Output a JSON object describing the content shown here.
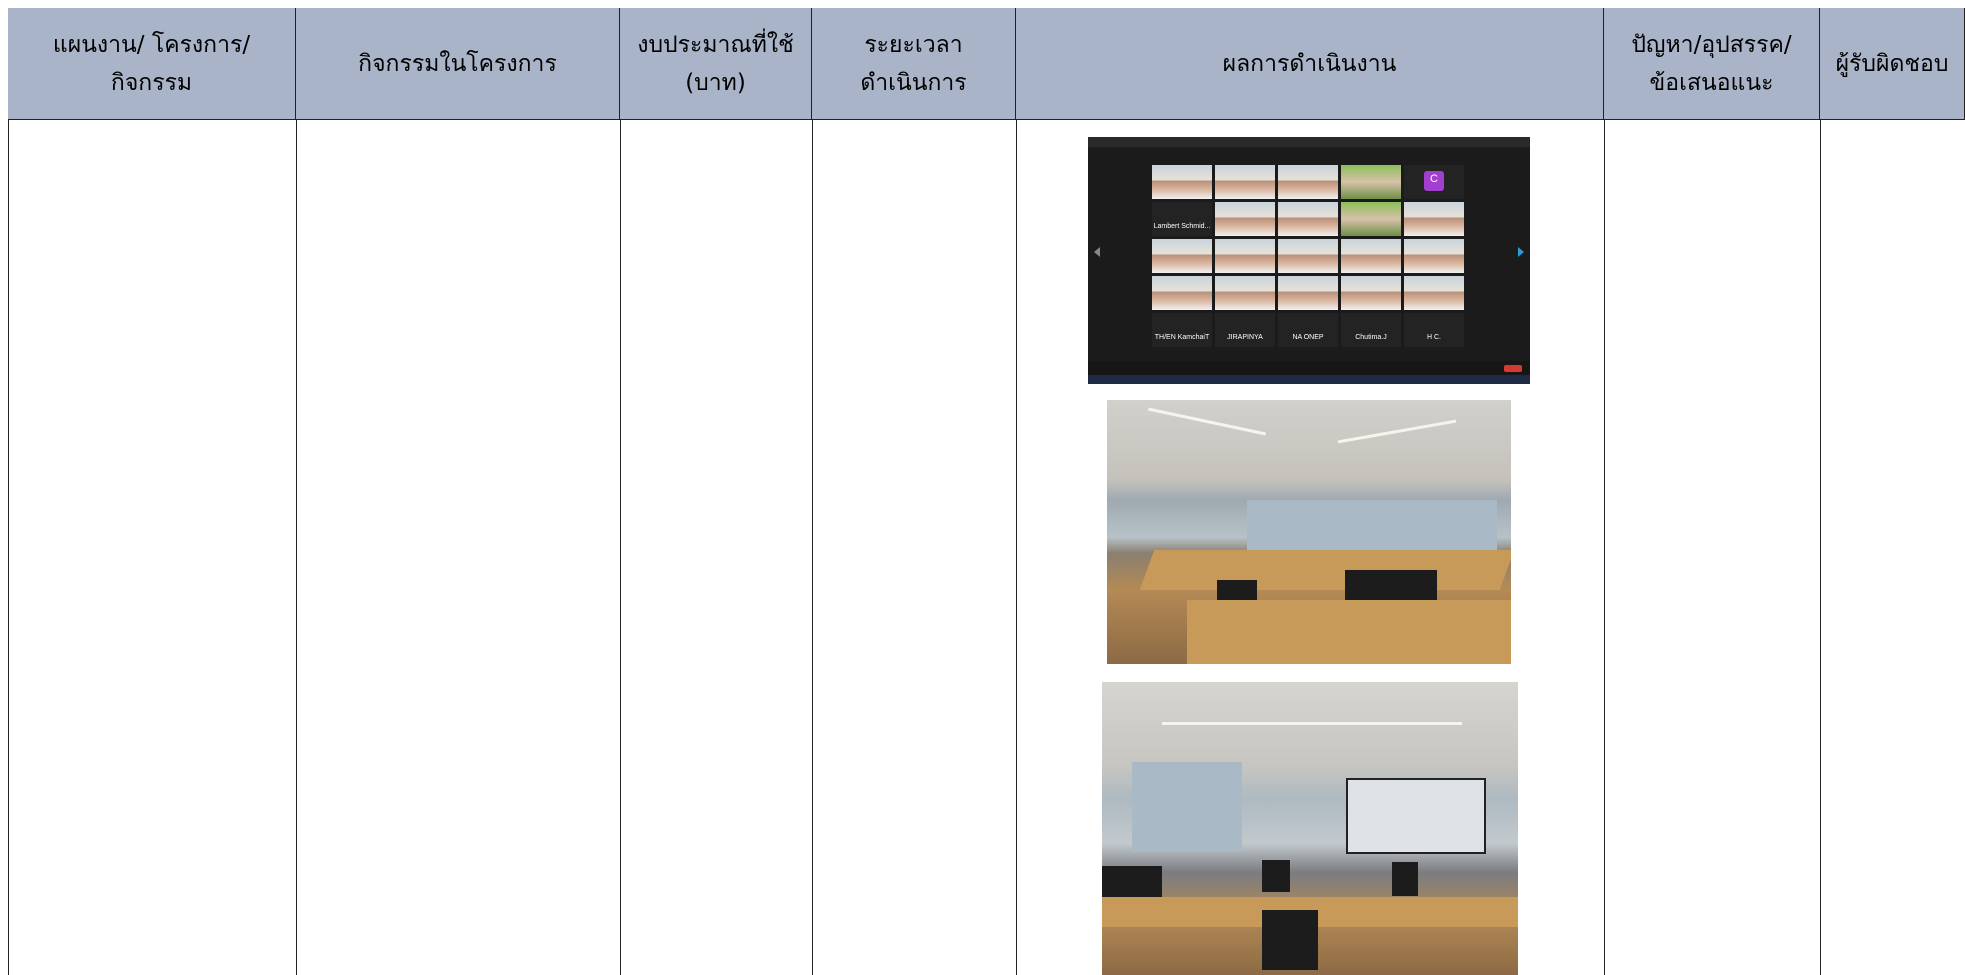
{
  "headers": [
    "แผนงาน/ โครงการ/\nกิจกรรม",
    "กิจกรรมในโครงการ",
    "งบประมาณที่ใช้\n(บาท)",
    "ระยะเวลา\nดำเนินการ",
    "ผลการดำเนินงาน",
    "ปัญหา/อุปสรรค/\nข้อเสนอแนะ",
    "ผู้รับผิดชอบ"
  ],
  "zoom": {
    "participants": [
      "Lambert Schmid...",
      "TH/EN KamchaiT",
      "JIRAPINYA",
      "NA ONEP",
      "Chutima.J",
      "H C."
    ],
    "avatar_letter": "C"
  },
  "colors": {
    "header_bg": "#a9b4c8",
    "border": "#222222",
    "zoom_end_button": "#d63a2f"
  }
}
